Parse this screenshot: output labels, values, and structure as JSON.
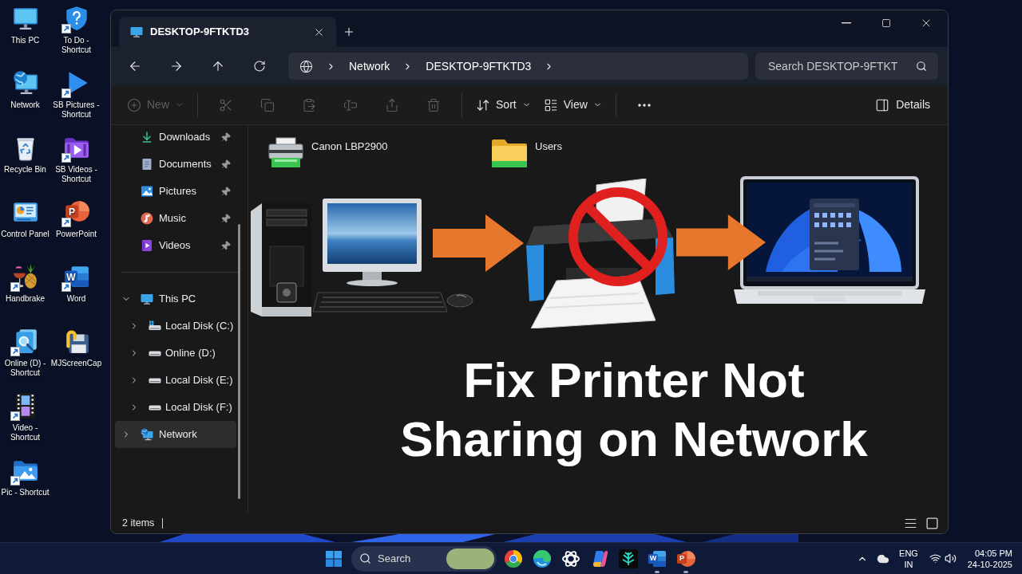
{
  "desktop": {
    "columns": [
      {
        "icons": [
          {
            "label": "This PC",
            "kind": "pc",
            "shortcut": false
          },
          {
            "label": "Network",
            "kind": "network",
            "shortcut": false
          },
          {
            "label": "Recycle Bin",
            "kind": "recycle",
            "shortcut": false
          },
          {
            "label": "Control Panel",
            "kind": "control",
            "shortcut": false
          },
          {
            "label": "Handbrake",
            "kind": "fruit",
            "shortcut": true
          },
          {
            "label": "Online (D) - Shortcut",
            "kind": "search",
            "shortcut": true
          },
          {
            "label": "Video - Shortcut",
            "kind": "film",
            "shortcut": true
          },
          {
            "label": "Pic - Shortcut",
            "kind": "picture",
            "shortcut": true
          }
        ]
      },
      {
        "icons": [
          {
            "label": "To Do - Shortcut",
            "kind": "help",
            "shortcut": true
          },
          {
            "label": "SB Pictures - Shortcut",
            "kind": "play",
            "shortcut": true
          },
          {
            "label": "SB Videos - Shortcut",
            "kind": "video",
            "shortcut": true
          },
          {
            "label": "PowerPoint",
            "kind": "slides",
            "glyph": "P",
            "shortcut": true
          },
          {
            "label": "Word",
            "kind": "doc",
            "glyph": "W",
            "shortcut": true
          },
          {
            "label": "MJScreenCap",
            "kind": "floppy",
            "shortcut": false
          }
        ]
      }
    ]
  },
  "explorer": {
    "tabs": [
      {
        "title": "DESKTOP-9FTKTD3",
        "selected": true
      }
    ],
    "address": {
      "crumbs": [
        "Network",
        "DESKTOP-9FTKTD3"
      ]
    },
    "search": {
      "placeholder": "Search DESKTOP-9FTKT"
    },
    "toolbar": [
      {
        "kind": "new",
        "label": "New",
        "disabled": true
      },
      {
        "kind": "cut",
        "disabled": true
      },
      {
        "kind": "copy",
        "disabled": true
      },
      {
        "kind": "paste",
        "disabled": true
      },
      {
        "kind": "rename",
        "disabled": true
      },
      {
        "kind": "share",
        "disabled": true
      },
      {
        "kind": "delete",
        "disabled": true
      },
      {
        "kind": "sort",
        "label": "Sort",
        "disabled": false
      },
      {
        "kind": "view",
        "label": "View",
        "disabled": false
      },
      {
        "kind": "more",
        "disabled": false
      }
    ],
    "details_button": {
      "label": "Details"
    },
    "sidebar": {
      "pinned": [
        {
          "label": "Downloads",
          "kind": "downloads",
          "pinned": true
        },
        {
          "label": "Documents",
          "kind": "documents",
          "pinned": true
        },
        {
          "label": "Pictures",
          "kind": "pictures",
          "pinned": true
        },
        {
          "label": "Music",
          "kind": "music",
          "pinned": true
        },
        {
          "label": "Videos",
          "kind": "videos",
          "pinned": true
        }
      ],
      "tree": [
        {
          "label": "This PC",
          "kind": "pc",
          "expanded": true,
          "selected": false,
          "children": [
            {
              "label": "Local Disk (C:)",
              "kind": "system-disk",
              "expanded": false,
              "selected": false
            },
            {
              "label": "Online (D:)",
              "kind": "disk",
              "expanded": false,
              "selected": false
            },
            {
              "label": "Local Disk (E:)",
              "kind": "disk",
              "expanded": false,
              "selected": false
            },
            {
              "label": "Local Disk (F:)",
              "kind": "disk",
              "expanded": false,
              "selected": false
            }
          ]
        },
        {
          "label": "Network",
          "kind": "network",
          "expanded": false,
          "selected": true
        }
      ]
    },
    "items": [
      {
        "name": "Canon LBP2900",
        "kind": "printer"
      },
      {
        "name": "Users",
        "kind": "folder"
      }
    ],
    "status_bar": {
      "count": "2 items"
    }
  },
  "thumbnail": {
    "headline": "Fix Printer Not Sharing on Network"
  },
  "taskbar": {
    "search": {
      "placeholder": "Search"
    },
    "apps": [
      {
        "kind": "ring",
        "running": false
      },
      {
        "kind": "wave",
        "running": false
      },
      {
        "kind": "knot",
        "running": false
      },
      {
        "kind": "swirl",
        "running": false
      },
      {
        "kind": "tile",
        "running": false
      },
      {
        "kind": "doc",
        "glyph": "W",
        "running": true
      },
      {
        "kind": "slides",
        "glyph": "P",
        "running": true
      }
    ],
    "tray": {
      "language": "ENG",
      "region": "IN",
      "time": "04:05 PM",
      "date": "24-10-2025"
    }
  }
}
